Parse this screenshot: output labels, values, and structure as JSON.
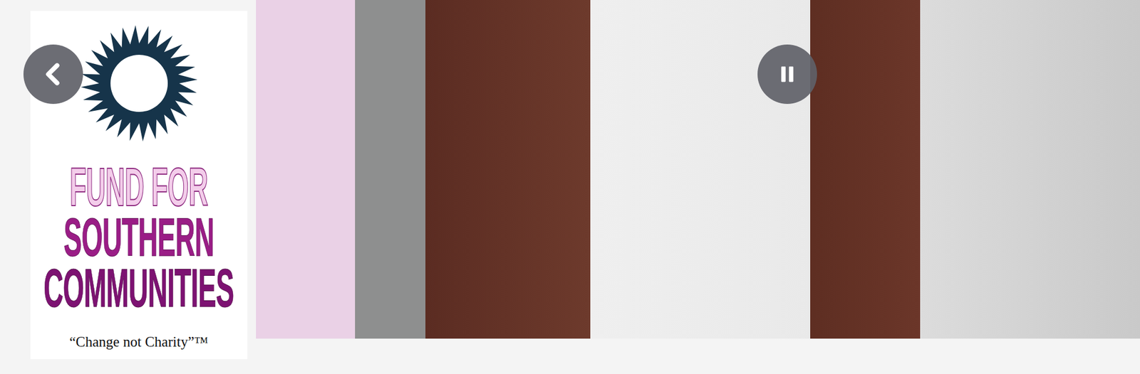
{
  "logo": {
    "lines": [
      "FUND FOR",
      "SOUTHERN",
      "COMMUNITIES"
    ],
    "tagline": "“Change not Charity”™"
  },
  "slideshow": {
    "playing": true
  }
}
